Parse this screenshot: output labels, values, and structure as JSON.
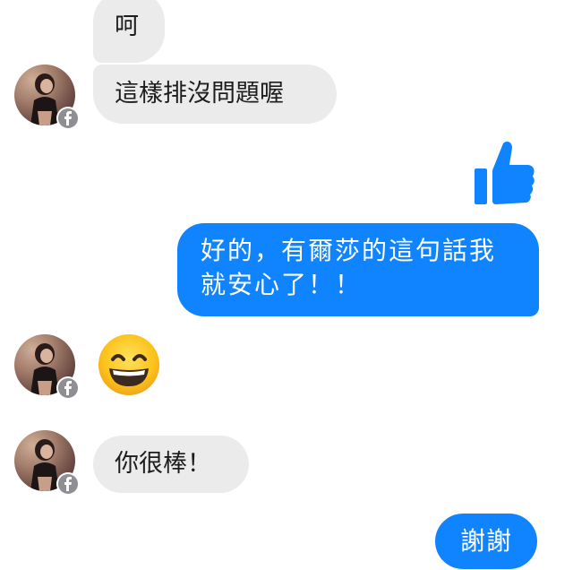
{
  "conversation": {
    "messages": [
      {
        "sender": "incoming",
        "text": "呵"
      },
      {
        "sender": "incoming",
        "text": "這樣排沒問題喔"
      },
      {
        "sender": "outgoing",
        "sticker": "thumbs-up"
      },
      {
        "sender": "outgoing",
        "text": "好的，有爾莎的這句話我就安心了！！"
      },
      {
        "sender": "incoming",
        "emoji": "grinning-face-with-smiling-eyes"
      },
      {
        "sender": "incoming",
        "text": "你很棒！"
      },
      {
        "sender": "outgoing",
        "text": "謝謝"
      }
    ]
  },
  "colors": {
    "incoming_bubble": "#ebebeb",
    "outgoing_bubble": "#0f84fe",
    "thumb_icon": "#0f84fe",
    "badge": "#8e8e93"
  },
  "icons": {
    "avatar_badge": "facebook-icon",
    "like_sticker": "thumbs-up-icon",
    "emoji": "grinning-emoji-icon"
  }
}
